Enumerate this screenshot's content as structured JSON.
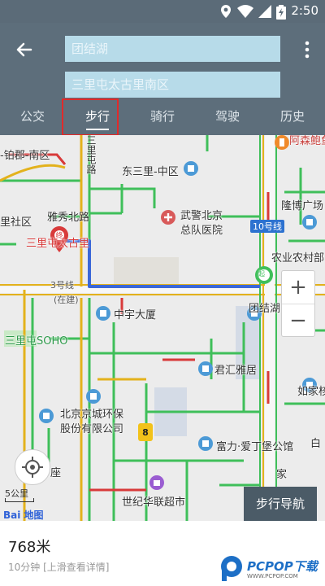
{
  "status_bar": {
    "time": "2:50"
  },
  "header": {
    "start_field": "团结湖",
    "end_field": "三里屯太古里南区",
    "tabs": [
      {
        "label": "公交"
      },
      {
        "label": "步行"
      },
      {
        "label": "骑行"
      },
      {
        "label": "驾驶"
      },
      {
        "label": "历史"
      }
    ],
    "active_tab": "步行"
  },
  "map": {
    "labels": {
      "nanqu": "-铂郡-南区",
      "sanlitun_lu": "三里屯路",
      "dongsanli": "东三里-中区",
      "ahsen": "阿森鲍鱼",
      "longteng": "隆博广场",
      "sanlishequ": "里社区",
      "yaxiu_beilu": "雅秀北路",
      "wujing_1": "武警北京",
      "wujing_2": "总队医院",
      "line10": "10号线",
      "sanli_taigu": "三里屯太古里",
      "nongye": "农业农村部",
      "qi_badge": "起",
      "line3": "3号线",
      "zaijian": "(在建)",
      "zhongyu": "中宇大厦",
      "tuanjiehu": "团结湖",
      "soho": "三里屯SOHO",
      "junhui": "君汇雅居",
      "rujia": "如家核",
      "jingcheng_1": "北京京城环保",
      "jingcheng_2": "股份有限公司",
      "fuli": "富力·爱丁堡公馆",
      "bai": "白",
      "zuo": "座",
      "shiji": "世纪华联超市",
      "jia": "家"
    },
    "scale": "5公里",
    "logo_text": "Bai 地图",
    "zoom_in": "+",
    "zoom_out": "−",
    "walk_nav_button": "步行导航"
  },
  "route": {
    "distance": "768米",
    "duration": "10分钟",
    "details_hint": "[上滑查看详情]"
  },
  "watermark": {
    "brand": "PCPOP下载",
    "sub": "WWW.PCPOP.COM"
  },
  "colors": {
    "header_bg": "#5d6e7b",
    "field_bg": "#b7dbe9",
    "route": "#3a67d8",
    "road_green": "#3fbf5a",
    "road_yellow": "#e3b21c",
    "road_red": "#d83a3a",
    "highlight_border": "#e02a2a"
  }
}
